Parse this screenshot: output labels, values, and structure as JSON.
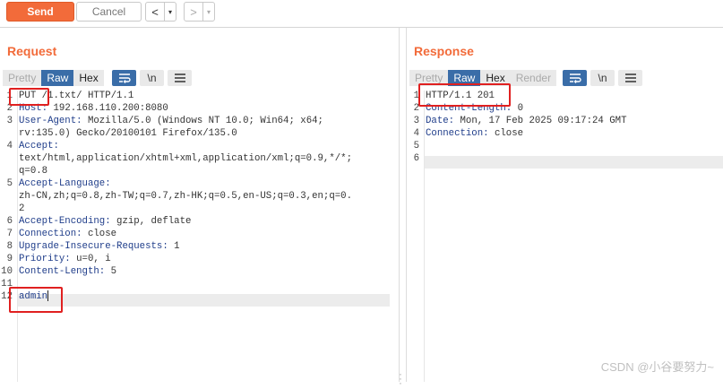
{
  "toolbar": {
    "send_label": "Send",
    "cancel_label": "Cancel",
    "back_glyph": "<",
    "forward_glyph": ">",
    "dropdown_glyph": "▾"
  },
  "request": {
    "title": "Request",
    "tabs": [
      "Pretty",
      "Raw",
      "Hex"
    ],
    "active_tab": "Raw",
    "wrap_icon": "wrap-lines-icon",
    "newline_label": "\\n",
    "menu_icon": "menu-icon",
    "lines": [
      {
        "n": "1",
        "key": "",
        "text": "PUT /1.txt/ HTTP/1.1"
      },
      {
        "n": "2",
        "key": "Host:",
        "text": " 192.168.110.200:8080"
      },
      {
        "n": "3",
        "key": "User-Agent:",
        "text": " Mozilla/5.0 (Windows NT 10.0; Win64; x64;"
      },
      {
        "n": "",
        "key": "",
        "text": "rv:135.0) Gecko/20100101 Firefox/135.0"
      },
      {
        "n": "4",
        "key": "Accept:",
        "text": ""
      },
      {
        "n": "",
        "key": "",
        "text": "text/html,application/xhtml+xml,application/xml;q=0.9,*/*;"
      },
      {
        "n": "",
        "key": "",
        "text": "q=0.8"
      },
      {
        "n": "5",
        "key": "Accept-Language:",
        "text": ""
      },
      {
        "n": "",
        "key": "",
        "text": "zh-CN,zh;q=0.8,zh-TW;q=0.7,zh-HK;q=0.5,en-US;q=0.3,en;q=0."
      },
      {
        "n": "",
        "key": "",
        "text": "2"
      },
      {
        "n": "6",
        "key": "Accept-Encoding:",
        "text": " gzip, deflate"
      },
      {
        "n": "7",
        "key": "Connection:",
        "text": " close"
      },
      {
        "n": "8",
        "key": "Upgrade-Insecure-Requests:",
        "text": " 1"
      },
      {
        "n": "9",
        "key": "Priority:",
        "text": " u=0, i"
      },
      {
        "n": "10",
        "key": "Content-Length:",
        "text": " 5"
      },
      {
        "n": "11",
        "key": "",
        "text": ""
      },
      {
        "n": "12",
        "key": "",
        "text": "admin"
      }
    ]
  },
  "response": {
    "title": "Response",
    "tabs": [
      "Pretty",
      "Raw",
      "Hex",
      "Render"
    ],
    "active_tab": "Raw",
    "wrap_icon": "wrap-lines-icon",
    "newline_label": "\\n",
    "menu_icon": "menu-icon",
    "lines": [
      {
        "n": "1",
        "key": "",
        "text": "HTTP/1.1 201"
      },
      {
        "n": "2",
        "key": "Content-Length:",
        "text": " 0"
      },
      {
        "n": "3",
        "key": "Date:",
        "text": " Mon, 17 Feb 2025 09:17:24 GMT"
      },
      {
        "n": "4",
        "key": "Connection:",
        "text": " close"
      },
      {
        "n": "5",
        "key": "",
        "text": ""
      },
      {
        "n": "6",
        "key": "",
        "text": ""
      }
    ]
  },
  "watermark": "CSDN @小谷要努力~",
  "colors": {
    "accent": "#f26b3a",
    "active_tab": "#3a6da8",
    "highlight_box": "#e02020",
    "header_key": "#1f3d8a"
  }
}
